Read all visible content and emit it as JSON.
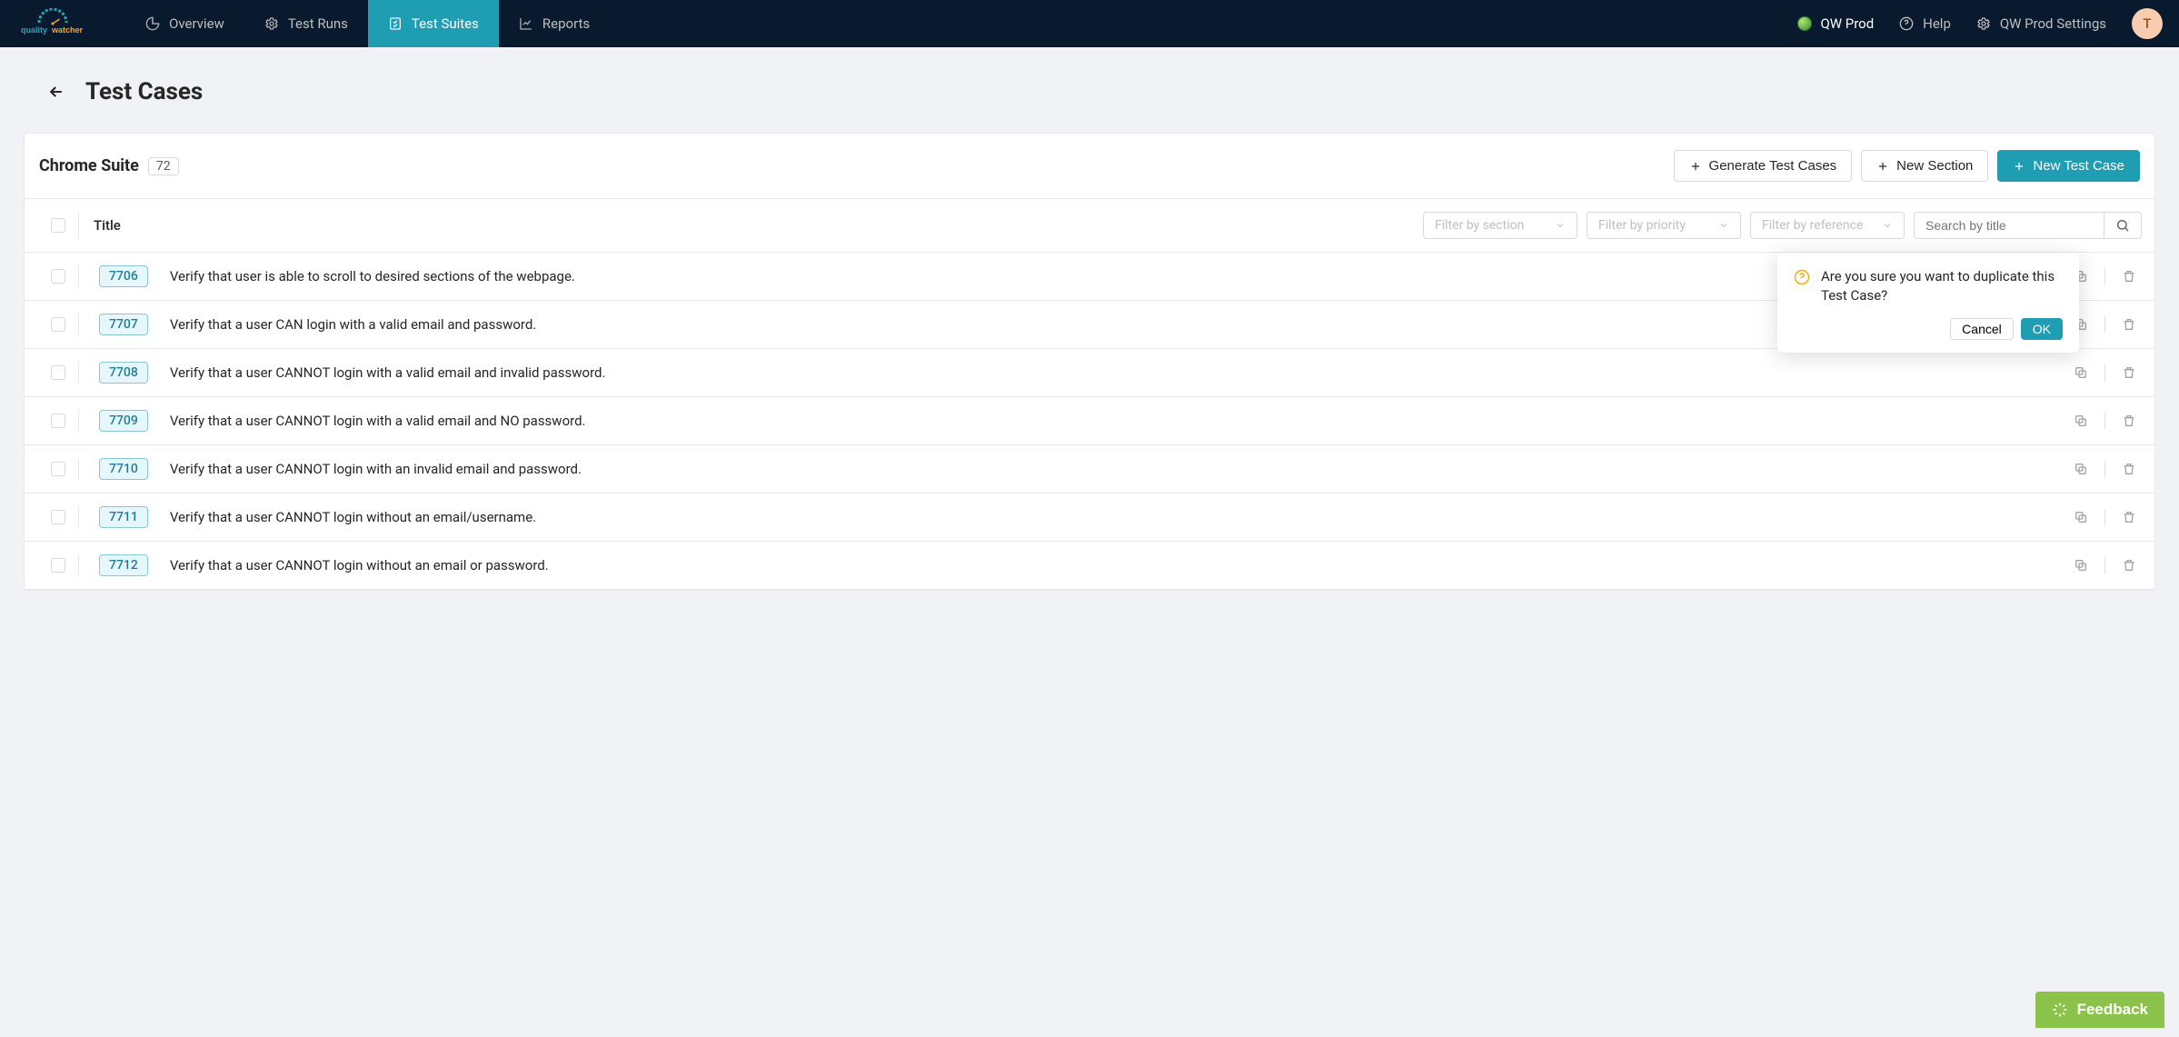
{
  "brand": "qualitywatcher",
  "nav": {
    "overview": "Overview",
    "test_runs": "Test Runs",
    "test_suites": "Test Suites",
    "reports": "Reports"
  },
  "right_nav": {
    "project": "QW Prod",
    "help": "Help",
    "settings": "QW Prod Settings",
    "avatar_initial": "T"
  },
  "page": {
    "title": "Test Cases",
    "suite_name": "Chrome Suite",
    "suite_count": "72"
  },
  "buttons": {
    "generate": "Generate Test Cases",
    "new_section": "New Section",
    "new_test_case": "New Test Case"
  },
  "table": {
    "title_col": "Title",
    "filters": {
      "section": "Filter by section",
      "priority": "Filter by priority",
      "reference": "Filter by reference"
    },
    "search_placeholder": "Search by title"
  },
  "rows": [
    {
      "id": "7706",
      "title": "Verify that user is able to scroll to desired sections of the webpage."
    },
    {
      "id": "7707",
      "title": "Verify that a user CAN login with a valid email and password."
    },
    {
      "id": "7708",
      "title": "Verify that a user CANNOT login with a valid email and invalid password."
    },
    {
      "id": "7709",
      "title": "Verify that a user CANNOT login with a valid email and NO password."
    },
    {
      "id": "7710",
      "title": "Verify that a user CANNOT login with an invalid email and password."
    },
    {
      "id": "7711",
      "title": "Verify that a user CANNOT login without an email/username."
    },
    {
      "id": "7712",
      "title": "Verify that a user CANNOT login without an email or password."
    }
  ],
  "popover": {
    "text": "Are you sure you want to duplicate this Test Case?",
    "cancel": "Cancel",
    "ok": "OK"
  },
  "feedback": "Feedback"
}
